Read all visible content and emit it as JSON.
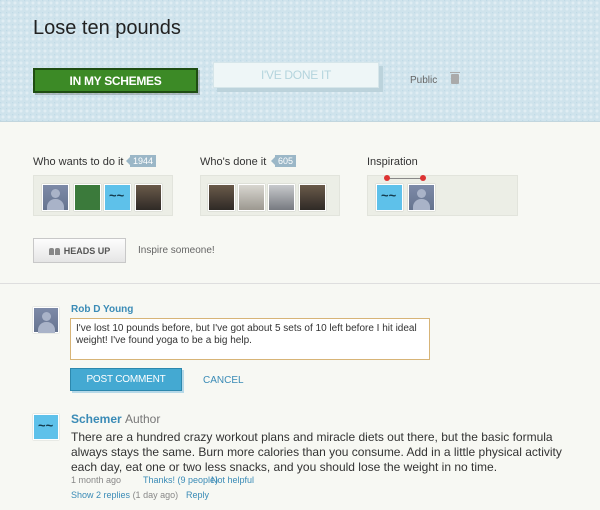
{
  "header": {
    "title": "Lose ten pounds",
    "in_schemes_label": "IN MY SCHEMES",
    "done_label": "I'VE DONE IT",
    "visibility": "Public"
  },
  "who_wants": {
    "label": "Who wants to do it",
    "count": "1944"
  },
  "whos_done": {
    "label": "Who's done it",
    "count": "605"
  },
  "inspiration": {
    "label": "Inspiration"
  },
  "heads_up": {
    "label": "HEADS UP",
    "hint": "Inspire someone!"
  },
  "comment_form": {
    "user_name": "Rob D Young",
    "text": "I've lost 10 pounds before, but I've got about 5 sets of 10 left before I hit ideal weight! I've found yoga to be a big help.",
    "post_label": "POST COMMENT",
    "cancel_label": "CANCEL"
  },
  "comment": {
    "author": "Schemer",
    "role": "Author",
    "body": "There are a hundred crazy workout plans and miracle diets out there, but the basic formula always stays the same. Burn more calories than you consume. Add in a little physical activity each day, eat one or two less snacks, and you should lose the weight in no time.",
    "time": "1 month ago",
    "thanks": "Thanks! (9 people)",
    "not_helpful": "Not helpful",
    "show_replies": "Show 2 replies",
    "replies_age": "(1 day ago)",
    "reply_label": "Reply"
  },
  "colors": {
    "accent_green": "#3c8a26",
    "link_blue": "#3a8bb6",
    "button_blue": "#44a9d2"
  }
}
